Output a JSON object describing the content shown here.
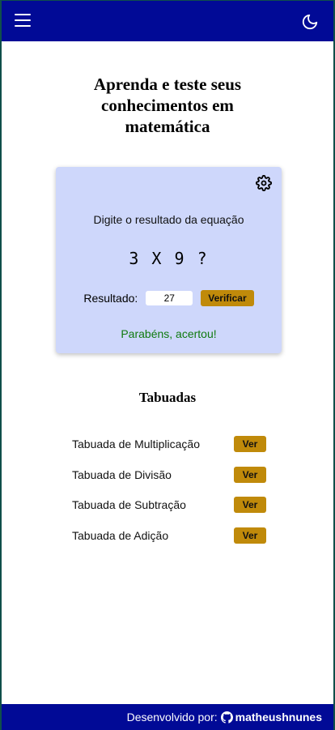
{
  "header": {
    "menu_icon": "hamburger-menu-icon",
    "theme_icon": "moon-icon",
    "bg_color": "#010a96"
  },
  "main": {
    "title": "Aprenda e teste seus conhecimentos em matemática"
  },
  "quiz": {
    "settings_icon": "gear-icon",
    "instruction": "Digite o resultado da equação",
    "equation": "3 X 9 ?",
    "result_label": "Resultado:",
    "result_value": "27",
    "verify_label": "Verificar",
    "feedback": "Parabéns, acertou!",
    "feedback_color": "#0f7a0f",
    "card_color": "#ced7fb",
    "button_color": "#c08a0a"
  },
  "tables": {
    "title": "Tabuadas",
    "items": [
      {
        "label": "Tabuada de Multiplicação",
        "button": "Ver"
      },
      {
        "label": "Tabuada de Divisão",
        "button": "Ver"
      },
      {
        "label": "Tabuada de Subtração",
        "button": "Ver"
      },
      {
        "label": "Tabuada de Adição",
        "button": "Ver"
      }
    ]
  },
  "footer": {
    "label": "Desenvolvido por:",
    "icon": "github-icon",
    "author": "matheushnunes"
  }
}
